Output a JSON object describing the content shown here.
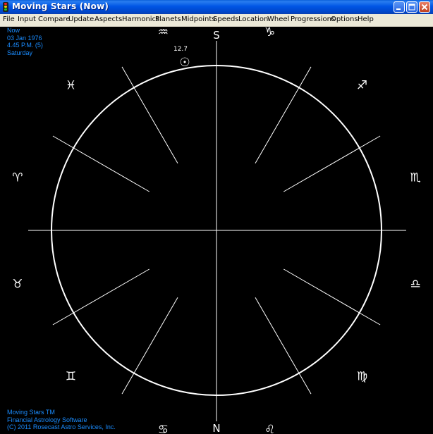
{
  "window": {
    "title": "Moving Stars (Now)"
  },
  "menu": [
    "File",
    "Input",
    "Compare",
    "Update",
    "Aspects",
    "Harmonics",
    "Planets",
    "Midpoints",
    "Speeds",
    "Location",
    "Wheel",
    "Progressions",
    "Options",
    "Help"
  ],
  "chart_info": {
    "line1": "Now",
    "line2": "03 Jan 1976",
    "line3": "4.45 P.M. (5)",
    "line4": "Saturday"
  },
  "footer": {
    "line1": "Moving Stars TM",
    "line2": "Financial Astrology Software",
    "line3": "(C) 2011 Rosecast Astro Services, Inc."
  },
  "wheel": {
    "south_label": "S",
    "north_label": "N",
    "planet_symbol": "☉",
    "planet_degree": "12.7"
  },
  "zodiac": [
    {
      "sign": "capricorn",
      "glyph": "♑"
    },
    {
      "sign": "sagittarius",
      "glyph": "♐"
    },
    {
      "sign": "scorpio",
      "glyph": "♏"
    },
    {
      "sign": "libra",
      "glyph": "♎"
    },
    {
      "sign": "virgo",
      "glyph": "♍"
    },
    {
      "sign": "leo",
      "glyph": "♌"
    },
    {
      "sign": "cancer",
      "glyph": "♋"
    },
    {
      "sign": "gemini",
      "glyph": "♊"
    },
    {
      "sign": "taurus",
      "glyph": "♉"
    },
    {
      "sign": "aries",
      "glyph": "♈"
    },
    {
      "sign": "pisces",
      "glyph": "♓"
    },
    {
      "sign": "aquarius",
      "glyph": "♒"
    }
  ],
  "colors": {
    "background": "#000000",
    "wheel_lines": "#ffffff",
    "info_text": "#1a8cff",
    "titlebar": "#0055e5",
    "menubar": "#ece9d8"
  }
}
